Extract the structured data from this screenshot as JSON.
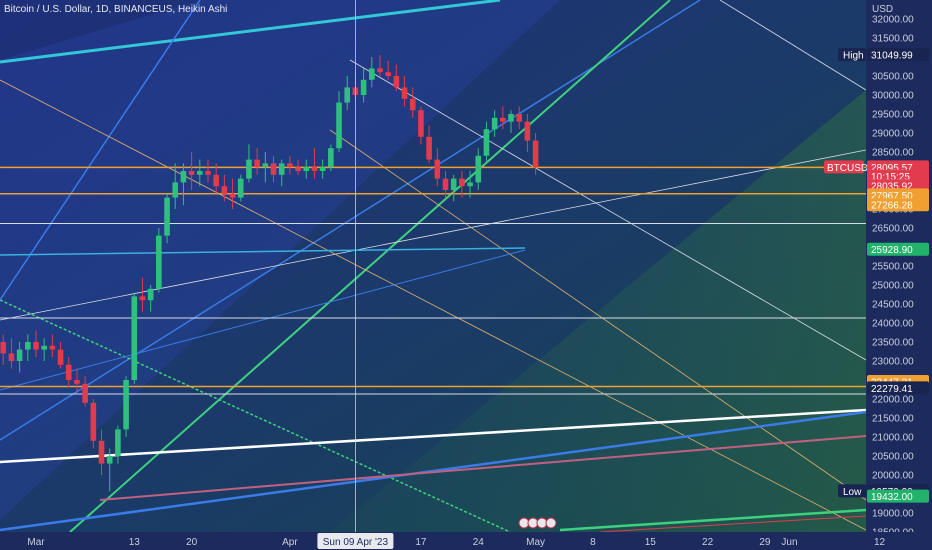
{
  "header": {
    "title": "Bitcoin / U.S. Dollar, 1D, BINANCEUS, Heikin Ashi"
  },
  "chart_data": {
    "type": "candlestick",
    "title": "Bitcoin / U.S. Dollar, 1D, BINANCEUS, Heikin Ashi",
    "currency": "USD",
    "ylim": [
      18500,
      32500
    ],
    "y_ticks": [
      18500,
      19000,
      19500,
      20000,
      20500,
      21000,
      21500,
      22000,
      22500,
      23000,
      23500,
      24000,
      24500,
      25000,
      25500,
      26000,
      26500,
      27000,
      27500,
      28000,
      28500,
      29000,
      29500,
      30000,
      30500,
      31000,
      31500,
      32000
    ],
    "x_ticks": [
      {
        "label": "Mar",
        "day": 0
      },
      {
        "label": "13",
        "day": 12
      },
      {
        "label": "20",
        "day": 19
      },
      {
        "label": "Apr",
        "day": 31
      },
      {
        "label": "17",
        "day": 47
      },
      {
        "label": "24",
        "day": 54
      },
      {
        "label": "May",
        "day": 61
      },
      {
        "label": "8",
        "day": 68
      },
      {
        "label": "15",
        "day": 75
      },
      {
        "label": "22",
        "day": 82
      },
      {
        "label": "29",
        "day": 89
      },
      {
        "label": "Jun",
        "day": 92
      },
      {
        "label": "12",
        "day": 103
      }
    ],
    "crosshair": {
      "label": "Sun 09 Apr '23",
      "day": 39
    },
    "candles": [
      {
        "o": 23500,
        "h": 23700,
        "l": 22900,
        "c": 23200
      },
      {
        "o": 23200,
        "h": 23600,
        "l": 22800,
        "c": 23000
      },
      {
        "o": 23000,
        "h": 23500,
        "l": 22700,
        "c": 23300
      },
      {
        "o": 23300,
        "h": 23700,
        "l": 23000,
        "c": 23500
      },
      {
        "o": 23500,
        "h": 23800,
        "l": 23100,
        "c": 23300
      },
      {
        "o": 23300,
        "h": 23600,
        "l": 23000,
        "c": 23400
      },
      {
        "o": 23400,
        "h": 23700,
        "l": 23100,
        "c": 23300
      },
      {
        "o": 23300,
        "h": 23500,
        "l": 22800,
        "c": 22900
      },
      {
        "o": 22900,
        "h": 23100,
        "l": 22300,
        "c": 22500
      },
      {
        "o": 22500,
        "h": 22800,
        "l": 22200,
        "c": 22400
      },
      {
        "o": 22400,
        "h": 22600,
        "l": 21800,
        "c": 21900
      },
      {
        "o": 21900,
        "h": 22000,
        "l": 20700,
        "c": 20900
      },
      {
        "o": 20900,
        "h": 21200,
        "l": 20000,
        "c": 20300
      },
      {
        "o": 20300,
        "h": 20700,
        "l": 19570,
        "c": 20500
      },
      {
        "o": 20500,
        "h": 21300,
        "l": 20300,
        "c": 21200
      },
      {
        "o": 21200,
        "h": 22600,
        "l": 21000,
        "c": 22500
      },
      {
        "o": 22500,
        "h": 24800,
        "l": 22400,
        "c": 24700
      },
      {
        "o": 24700,
        "h": 25200,
        "l": 24300,
        "c": 24600
      },
      {
        "o": 24600,
        "h": 25000,
        "l": 24300,
        "c": 24900
      },
      {
        "o": 24900,
        "h": 26500,
        "l": 24800,
        "c": 26300
      },
      {
        "o": 26300,
        "h": 27400,
        "l": 26100,
        "c": 27300
      },
      {
        "o": 27300,
        "h": 28200,
        "l": 27000,
        "c": 27700
      },
      {
        "o": 27700,
        "h": 28200,
        "l": 27100,
        "c": 28000
      },
      {
        "o": 28000,
        "h": 28500,
        "l": 27500,
        "c": 27900
      },
      {
        "o": 27900,
        "h": 28300,
        "l": 27600,
        "c": 28000
      },
      {
        "o": 28000,
        "h": 28300,
        "l": 27700,
        "c": 27900
      },
      {
        "o": 27900,
        "h": 28200,
        "l": 27400,
        "c": 27600
      },
      {
        "o": 27600,
        "h": 27900,
        "l": 27200,
        "c": 27400
      },
      {
        "o": 27400,
        "h": 27800,
        "l": 27000,
        "c": 27300
      },
      {
        "o": 27300,
        "h": 27900,
        "l": 27200,
        "c": 27800
      },
      {
        "o": 27800,
        "h": 28700,
        "l": 27700,
        "c": 28300
      },
      {
        "o": 28300,
        "h": 28600,
        "l": 27900,
        "c": 28100
      },
      {
        "o": 28100,
        "h": 28500,
        "l": 27700,
        "c": 28200
      },
      {
        "o": 28200,
        "h": 28400,
        "l": 27700,
        "c": 27900
      },
      {
        "o": 27900,
        "h": 28300,
        "l": 27600,
        "c": 28200
      },
      {
        "o": 28200,
        "h": 28400,
        "l": 27900,
        "c": 28100
      },
      {
        "o": 28100,
        "h": 28300,
        "l": 27900,
        "c": 28000
      },
      {
        "o": 28000,
        "h": 28300,
        "l": 27800,
        "c": 28100
      },
      {
        "o": 28100,
        "h": 28600,
        "l": 27800,
        "c": 28000
      },
      {
        "o": 28000,
        "h": 28300,
        "l": 27800,
        "c": 28100
      },
      {
        "o": 28100,
        "h": 28700,
        "l": 28000,
        "c": 28600
      },
      {
        "o": 28600,
        "h": 30100,
        "l": 28500,
        "c": 29800
      },
      {
        "o": 29800,
        "h": 30500,
        "l": 29600,
        "c": 30200
      },
      {
        "o": 30200,
        "h": 30600,
        "l": 29900,
        "c": 30000
      },
      {
        "o": 30000,
        "h": 30700,
        "l": 29800,
        "c": 30400
      },
      {
        "o": 30400,
        "h": 31000,
        "l": 30200,
        "c": 30700
      },
      {
        "o": 30700,
        "h": 31049.99,
        "l": 30500,
        "c": 30600
      },
      {
        "o": 30600,
        "h": 30900,
        "l": 30400,
        "c": 30500
      },
      {
        "o": 30500,
        "h": 30800,
        "l": 30100,
        "c": 30200
      },
      {
        "o": 30200,
        "h": 30500,
        "l": 29700,
        "c": 29900
      },
      {
        "o": 29900,
        "h": 30200,
        "l": 29400,
        "c": 29600
      },
      {
        "o": 29600,
        "h": 29700,
        "l": 28700,
        "c": 28900
      },
      {
        "o": 28900,
        "h": 29200,
        "l": 28200,
        "c": 28300
      },
      {
        "o": 28300,
        "h": 28600,
        "l": 27600,
        "c": 27800
      },
      {
        "o": 27800,
        "h": 28000,
        "l": 27300,
        "c": 27500
      },
      {
        "o": 27500,
        "h": 27900,
        "l": 27200,
        "c": 27800
      },
      {
        "o": 27800,
        "h": 28000,
        "l": 27300,
        "c": 27600
      },
      {
        "o": 27600,
        "h": 28000,
        "l": 27300,
        "c": 27700
      },
      {
        "o": 27700,
        "h": 28600,
        "l": 27500,
        "c": 28400
      },
      {
        "o": 28400,
        "h": 29300,
        "l": 28200,
        "c": 29100
      },
      {
        "o": 29100,
        "h": 29600,
        "l": 28900,
        "c": 29400
      },
      {
        "o": 29400,
        "h": 29700,
        "l": 29100,
        "c": 29300
      },
      {
        "o": 29300,
        "h": 29600,
        "l": 29000,
        "c": 29500
      },
      {
        "o": 29500,
        "h": 29700,
        "l": 29100,
        "c": 29300
      },
      {
        "o": 29300,
        "h": 29500,
        "l": 28500,
        "c": 28800
      },
      {
        "o": 28800,
        "h": 29000,
        "l": 27900,
        "c": 28095.57
      }
    ],
    "candle_start_day": -4,
    "horizontal_levels": [
      {
        "value": 28095.57,
        "color": "#f0a030"
      },
      {
        "value": 27400,
        "color": "#f0a030"
      },
      {
        "value": 26620,
        "color": "#d9dde8"
      },
      {
        "value": 24130,
        "color": "#d9dde8"
      },
      {
        "value": 22330,
        "color": "#f0a030"
      },
      {
        "value": 22130,
        "color": "#d9dde8"
      }
    ],
    "price_labels": [
      {
        "text": "High",
        "value": 31049.99,
        "prefix_box": true,
        "color": "#1a2450"
      },
      {
        "text": "BTCUSD",
        "value": 28095.57,
        "color": "#e23b4e"
      },
      {
        "text": "10:15:25",
        "value": 27850,
        "color": "#e23b4e"
      },
      {
        "text": "28035.92",
        "value": 27600,
        "color": "#e23b4e"
      },
      {
        "text": "27967.50",
        "value": 27360,
        "color": "#f0a030"
      },
      {
        "text": "27266.28",
        "value": 27100,
        "color": "#f0a030"
      },
      {
        "text": "25928.90",
        "value": 25928.9,
        "color": "#23b26b"
      },
      {
        "text": "22447.21",
        "value": 22447.21,
        "color": "#f0a030"
      },
      {
        "text": "22279.41",
        "value": 22279.41,
        "color": "#1a2450"
      },
      {
        "text": "Low",
        "value": 19570,
        "prefix_box": true,
        "color": "#1a2450"
      },
      {
        "text": "19432.00",
        "value": 19432,
        "color": "#23b26b"
      }
    ],
    "price_label_values": {
      "High": "31049.99",
      "BTCUSD": "28095.57",
      "Low": "19570.00"
    },
    "colors": {
      "up": "#2fbf7f",
      "down": "#e23b4e",
      "background": "#1c2a5e"
    }
  }
}
